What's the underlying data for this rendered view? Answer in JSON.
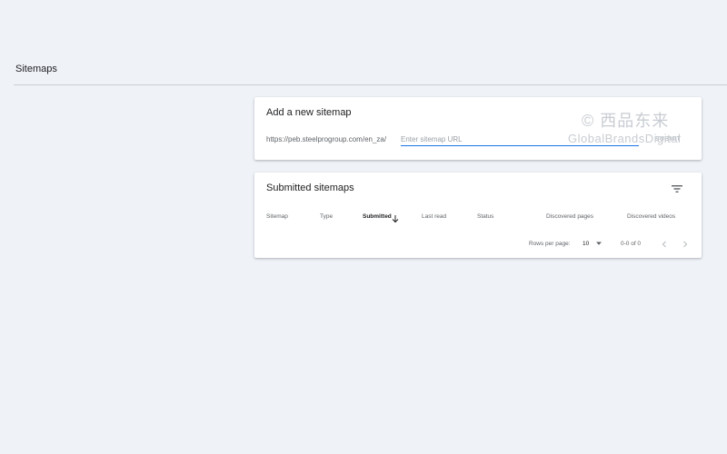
{
  "page": {
    "title": "Sitemaps"
  },
  "add_sitemap": {
    "title": "Add a new sitemap",
    "url_prefix": "https://peb.steelprogroup.com/en_za/",
    "input_placeholder": "Enter sitemap URL",
    "input_value": "",
    "submit_label": "SUBMIT"
  },
  "watermark": {
    "line1": "© 西品东来",
    "line2": "GlobalBrandsDigital"
  },
  "submitted_sitemaps": {
    "title": "Submitted sitemaps",
    "filter_icon": "filter-list-icon",
    "columns": [
      "Sitemap",
      "Type",
      "Submitted",
      "Last read",
      "Status",
      "Discovered pages",
      "Discovered videos"
    ],
    "sorted_column": "Submitted",
    "sort_direction": "descending",
    "pagination": {
      "rows_per_page_label": "Rows per page:",
      "rows_per_page_value": "10",
      "range_text": "0-0 of 0",
      "prev_icon": "chevron-left-icon",
      "next_icon": "chevron-right-icon"
    }
  },
  "colors": {
    "background": "#eff2f7",
    "card": "#ffffff",
    "accent": "#1a73e8",
    "text_primary": "#202124",
    "text_secondary": "#5f6368",
    "disabled": "#bdc1c6"
  }
}
